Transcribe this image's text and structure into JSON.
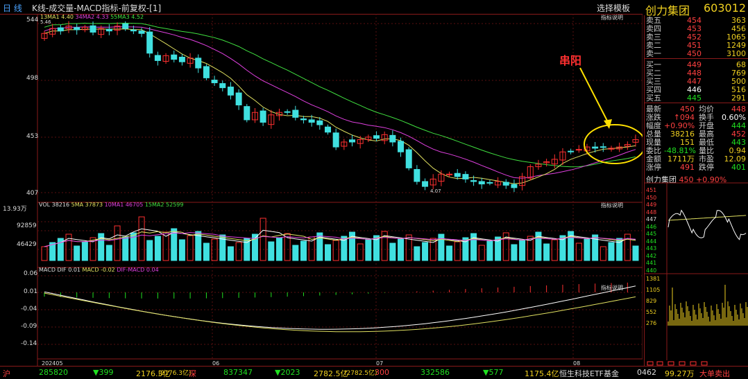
{
  "topbar": {
    "timeframe": "日 线",
    "title": "K线-成交量-MACD指标-前复权-[1]",
    "template": "选择模板"
  },
  "stock": {
    "name": "创力集团",
    "code": "603012"
  },
  "kline": {
    "ma_legend": {
      "ma1": "13MA1 4.40",
      "ma2": "34MA2 4.33",
      "ma3": "55MA3 4.52"
    },
    "help": "指标说明",
    "y_labels": [
      "544",
      "498",
      "453",
      "407"
    ],
    "max_label": "5.46",
    "min_label": "4.07",
    "annotation": "串阳",
    "colors": {
      "up": "#ff3030",
      "down": "#40e0e0",
      "ma1": "#e0e060",
      "ma2": "#e040e0",
      "ma3": "#40e040"
    }
  },
  "volume": {
    "legend": {
      "vol": "VOL 38216",
      "ma1": "5MA 37873",
      "ma2": "10MA1 46705",
      "ma3": "15MA2 52599"
    },
    "help": "指标说明",
    "top_label": "13.93万",
    "y_labels": [
      "92859",
      "46429"
    ]
  },
  "macd": {
    "legend": {
      "dif": "MACD DIF 0.01",
      "dea": "MACD -0.02",
      "bar": "DIF-MACD 0.04"
    },
    "help": "指标说明",
    "y_labels": [
      "0.06",
      "0.01",
      "-0.04",
      "-0.09",
      "-0.14"
    ]
  },
  "x_axis": {
    "labels": [
      "202405",
      "06",
      "07",
      "08"
    ]
  },
  "chart_data": {
    "type": "candlestick",
    "x": [
      "202405",
      "06",
      "07",
      "08"
    ],
    "y_range": [
      4.07,
      5.46
    ],
    "annotation": "串阳"
  },
  "quote": {
    "asks": [
      {
        "label": "卖五",
        "price": "454",
        "vol": "363"
      },
      {
        "label": "卖四",
        "price": "453",
        "vol": "456"
      },
      {
        "label": "卖三",
        "price": "452",
        "vol": "1065"
      },
      {
        "label": "卖二",
        "price": "451",
        "vol": "1249"
      },
      {
        "label": "卖一",
        "price": "450",
        "vol": "3100"
      }
    ],
    "bids": [
      {
        "label": "买一",
        "price": "449",
        "vol": "68"
      },
      {
        "label": "买二",
        "price": "448",
        "vol": "769"
      },
      {
        "label": "买三",
        "price": "447",
        "vol": "500"
      },
      {
        "label": "买四",
        "price": "446",
        "vol": "516"
      },
      {
        "label": "买五",
        "price": "445",
        "vol": "291"
      }
    ],
    "stats": [
      {
        "l1": "最新",
        "v1": "450",
        "l2": "均价",
        "v2": "448"
      },
      {
        "l1": "涨跌",
        "v1": "↑094",
        "l2": "换手",
        "v2": "0.60%"
      },
      {
        "l1": "幅度",
        "v1": "+0.90%",
        "l2": "开盘",
        "v2": "444"
      },
      {
        "l1": "总量",
        "v1": "38216",
        "l2": "最高",
        "v2": "452"
      },
      {
        "l1": "现量",
        "v1": "151",
        "l2": "最低",
        "v2": "443"
      },
      {
        "l1": "委比",
        "v1": "-48.81%",
        "l2": "量比",
        "v2": "0.94"
      },
      {
        "l1": "金额",
        "v1": "1711万",
        "l2": "市盈",
        "v2": "12.09"
      },
      {
        "l1": "涨停",
        "v1": "491",
        "l2": "跌停",
        "v2": "401"
      }
    ]
  },
  "mini": {
    "name": "创力集团",
    "price": "450",
    "pct": "+0.90%",
    "y_labels": [
      "451",
      "450",
      "449",
      "448",
      "447",
      "446",
      "445",
      "444",
      "443",
      "442",
      "441",
      "440"
    ],
    "vol_labels": [
      "1381",
      "1105",
      "829",
      "552",
      "276"
    ]
  },
  "bottom": {
    "sh": "沪",
    "sh_idx": "285820",
    "sh_chg": "▼399",
    "sh_amt": "2176.3亿",
    "sh_amt2": "(2176.3亿)",
    "sz": "深",
    "sz_idx": "837347",
    "sz_chg": "▼2023",
    "sz_amt": "2782.5亿",
    "sz_amt2": "(2782.5亿)",
    "cy": "300",
    "cy_idx": "332586",
    "cy_chg": "▼577",
    "cy_amt": "1175.4亿",
    "fund": "恒生科技ETF基金",
    "fund_v": "0462",
    "fund_amt": "99.27万",
    "big": "大单卖出"
  }
}
